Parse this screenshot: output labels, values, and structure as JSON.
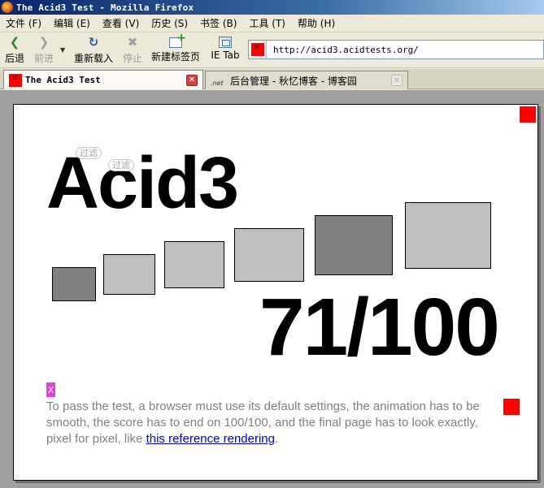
{
  "window": {
    "title": "The Acid3 Test - Mozilla Firefox"
  },
  "menu": [
    "文件 (F)",
    "编辑 (E)",
    "查看 (V)",
    "历史 (S)",
    "书签 (B)",
    "工具 (T)",
    "帮助 (H)"
  ],
  "toolbar": {
    "back": "后退",
    "forward": "前进",
    "reload": "重新载入",
    "stop": "停止",
    "new_tab": "新建标签页",
    "ie_tab": "IE Tab",
    "url": "http://acid3.acidtests.org/"
  },
  "tabs": [
    {
      "label": "The Acid3 Test",
      "active": true
    },
    {
      "label": "后台管理 - 秋忆博客 - 博客园",
      "active": false
    }
  ],
  "page": {
    "title": "Acid3",
    "bubble1": "过滤",
    "bubble2": "过滤",
    "score": "71/100",
    "x_icon": "X",
    "desc_before": "To pass the test, a browser must use its default settings, the animation has to be smooth, the score has to end on 100/100, and the final page has to look exactly, pixel for pixel, like ",
    "desc_link": "this reference rendering",
    "desc_after": "."
  },
  "colors": {
    "red": "#ff0000",
    "box_dark": "#808080",
    "box_light": "#c0c0c0",
    "x_magenta": "#e040e0"
  }
}
